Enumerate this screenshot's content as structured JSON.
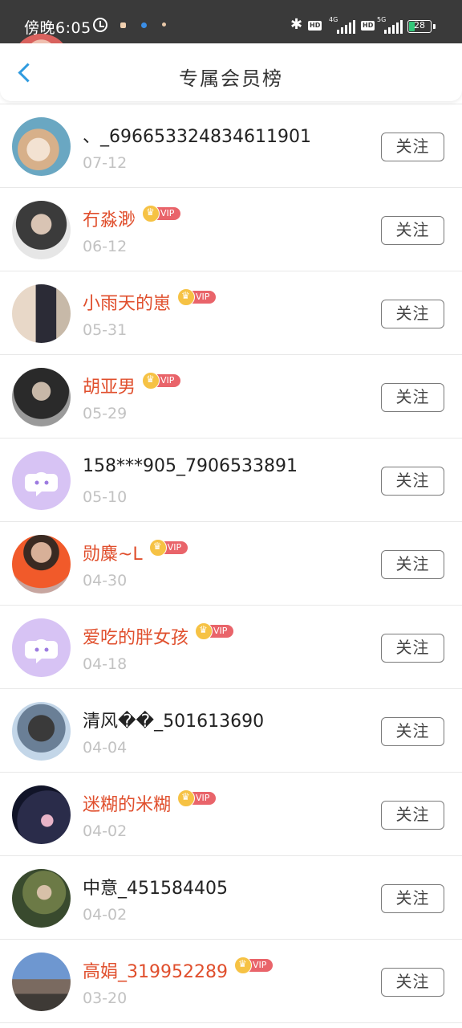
{
  "status_bar": {
    "time": "傍晚6:05",
    "network_1": "4G",
    "network_2": "5G",
    "hd": "HD",
    "battery": "28",
    "battery_level": 0.28
  },
  "header": {
    "title": "专属会员榜"
  },
  "follow_label": "关注",
  "vip_label": "VIP",
  "members": [
    {
      "name": "",
      "date": "07-12",
      "vip": false,
      "avatar": "pink"
    },
    {
      "name": "、_696653324834611901",
      "date": "07-12",
      "vip": false,
      "avatar": "cat"
    },
    {
      "name": "冇淼渺",
      "date": "06-12",
      "vip": true,
      "avatar": "man-dark"
    },
    {
      "name": "小雨天的崽",
      "date": "05-31",
      "vip": true,
      "avatar": "couple"
    },
    {
      "name": "胡亚男",
      "date": "05-29",
      "vip": true,
      "avatar": "violin"
    },
    {
      "name": "158***905_7906533891",
      "date": "05-10",
      "vip": false,
      "avatar": "default"
    },
    {
      "name": "勋麋~L",
      "date": "04-30",
      "vip": true,
      "avatar": "red-shirt"
    },
    {
      "name": "爱吃的胖女孩",
      "date": "04-18",
      "vip": true,
      "avatar": "default"
    },
    {
      "name": "清风��_501613690",
      "date": "04-04",
      "vip": false,
      "avatar": "girl-blue"
    },
    {
      "name": "迷糊的米糊",
      "date": "04-02",
      "vip": true,
      "avatar": "night"
    },
    {
      "name": "中意_451584405",
      "date": "04-02",
      "vip": false,
      "avatar": "green-girl"
    },
    {
      "name": "高娟_319952289",
      "date": "03-20",
      "vip": true,
      "avatar": "mountain"
    }
  ]
}
